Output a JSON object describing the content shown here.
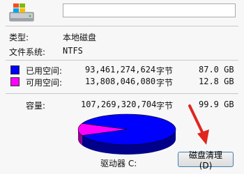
{
  "drive_name_value": "",
  "props": {
    "type_label": "类型:",
    "type_value": "本地磁盘",
    "fs_label": "文件系统:",
    "fs_value": "NTFS"
  },
  "usage": {
    "used_label": "已用空间:",
    "used_bytes": "93,461,274,624",
    "used_unit": "字节",
    "used_gb": "87.0 GB",
    "used_color": "#0000ff",
    "free_label": "可用空间:",
    "free_bytes": "13,808,046,080",
    "free_unit": "字节",
    "free_gb": "12.8 GB",
    "free_color": "#ff00ff",
    "capacity_label": "容量:",
    "capacity_bytes": "107,269,320,704",
    "capacity_unit": "字节",
    "capacity_gb": "99.9 GB",
    "used_fraction": 0.871
  },
  "drive_label": "驱动器 C:",
  "cleanup_button": "磁盘清理(D)",
  "icons": {
    "drive": "hard-drive-icon",
    "arrow": "red-arrow-icon"
  }
}
